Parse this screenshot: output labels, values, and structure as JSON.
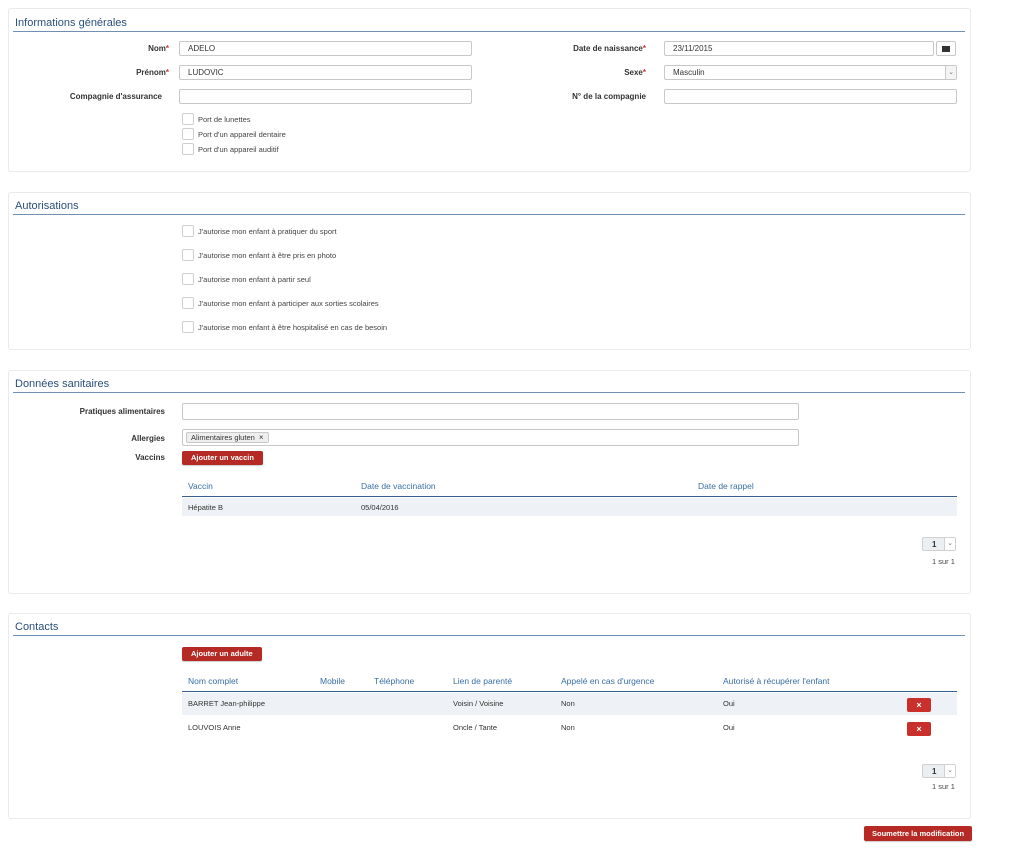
{
  "general": {
    "title": "Informations générales",
    "nom_label": "Nom",
    "nom_value": "ADELO",
    "prenom_label": "Prénom",
    "prenom_value": "LUDOVIC",
    "assurance_label": "Compagnie d'assurance",
    "assurance_value": "",
    "naissance_label": "Date de naissance",
    "naissance_value": "23/11/2015",
    "sexe_label": "Sexe",
    "sexe_value": "Masculin",
    "num_compagnie_label": "N° de la compagnie",
    "num_compagnie_value": "",
    "required_mark": "*",
    "checkboxes": [
      "Port de lunettes",
      "Port d'un appareil dentaire",
      "Port d'un appareil auditif"
    ]
  },
  "autorisations": {
    "title": "Autorisations",
    "items": [
      "J'autorise mon enfant à pratiquer du sport",
      "J'autorise mon enfant à être pris en photo",
      "J'autorise mon enfant à partir seul",
      "J'autorise mon enfant à participer aux sorties scolaires",
      "J'autorise mon enfant à être hospitalisé en cas de besoin"
    ]
  },
  "sanitaires": {
    "title": "Données sanitaires",
    "pratiques_label": "Pratiques alimentaires",
    "pratiques_value": "",
    "allergies_label": "Allergies",
    "allergy_tag": "Alimentaires gluten",
    "tag_remove": "×",
    "vaccins_label": "Vaccins",
    "add_vaccine": "Ajouter un vaccin",
    "columns": [
      "Vaccin",
      "Date de vaccination",
      "Date de rappel"
    ],
    "rows": [
      [
        "Hépatite B",
        "05/04/2016",
        ""
      ]
    ],
    "page": "1",
    "page_info": "1 sur 1"
  },
  "contacts": {
    "title": "Contacts",
    "add_adult": "Ajouter un adulte",
    "columns": [
      "Nom complet",
      "Mobile",
      "Téléphone",
      "Lien de parenté",
      "Appelé en cas d'urgence",
      "Autorisé à récupérer l'enfant"
    ],
    "rows": [
      [
        "BARRET Jean-philippe",
        "",
        "",
        "Voisin / Voisine",
        "Non",
        "Oui"
      ],
      [
        "LOUVOIS Anne",
        "",
        "",
        "Oncle / Tante",
        "Non",
        "Oui"
      ]
    ],
    "delete_glyph": "×",
    "page": "1",
    "page_info": "1 sur 1"
  },
  "submit": "Soumettre la modification",
  "icons": {
    "calendar": "calendar-icon",
    "chevron": "chevron-down-icon"
  },
  "colors": {
    "accent": "#b52a24",
    "title": "#2a4f7c",
    "header_text": "#3a6ea5"
  }
}
